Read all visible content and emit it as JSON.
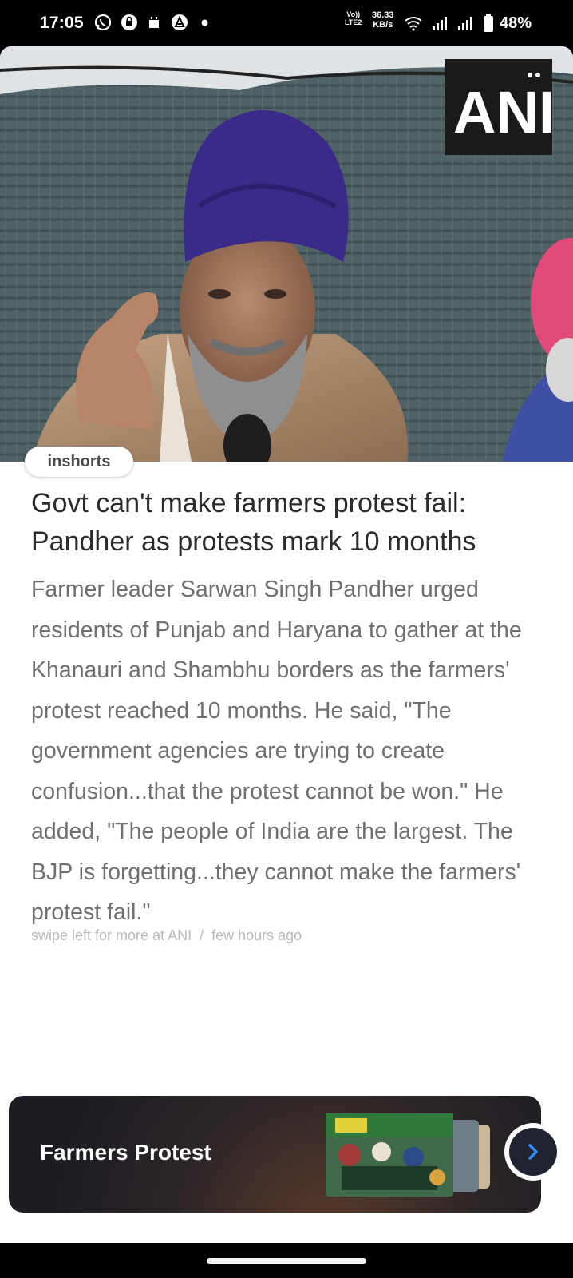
{
  "status_bar": {
    "time": "17:05",
    "network_label_top": "Vo))",
    "network_label_bottom": "LTE2",
    "speed_value": "36.33",
    "speed_unit": "KB/s",
    "battery": "48%"
  },
  "article": {
    "image_watermark": "ANI",
    "brand": "inshorts",
    "headline": "Govt can't make farmers protest fail: Pandher as protests mark 10 months",
    "body": "Farmer leader Sarwan Singh Pandher urged residents of Punjab and Haryana to gather at the Khanauri and Shambhu borders as the farmers' protest reached 10 months. He said, \"The government agencies are trying to create confusion...that the protest cannot be won.\" He added, \"The people of India are the largest. The BJP is forgetting...they cannot make the farmers' protest fail.\"",
    "meta_source": "swipe left for more at ANI",
    "meta_separator": "/",
    "meta_time": "few hours ago"
  },
  "banner": {
    "title": "Farmers Protest"
  },
  "colors": {
    "headline": "#2b2b2b",
    "body": "#6f6f6f",
    "meta": "#b9b9b9",
    "next_arrow": "#2f8cff",
    "turban": "#3a2a8a"
  },
  "icons": [
    "whatsapp-icon",
    "lock-icon",
    "sim-icon",
    "vpn-icon",
    "dot-icon",
    "wifi-icon",
    "signal-icon",
    "battery-icon",
    "chevron-right-icon"
  ]
}
